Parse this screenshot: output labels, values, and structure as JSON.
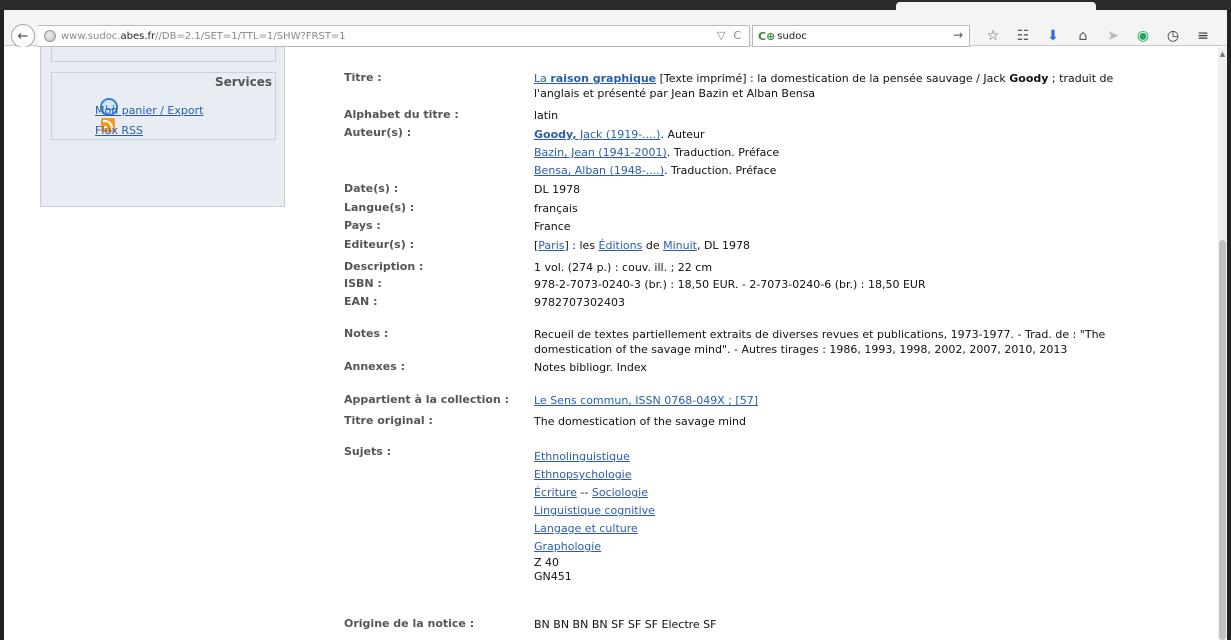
{
  "browser": {
    "url_prefix": "www.sudoc.",
    "url_host": "abes.fr",
    "url_path": "//DB=2.1/SET=1/TTL=1/SHW?FRST=1",
    "search_text": "sudoc",
    "reload_glyph": "C",
    "dropdown_glyph": "▽"
  },
  "services": {
    "title": "Services",
    "items": [
      {
        "label": "Mon panier / Export",
        "icon": "basket-icon"
      },
      {
        "label": "Flux RSS",
        "icon": "rss-icon"
      }
    ]
  },
  "record": {
    "titre": {
      "label": "Titre :",
      "link": "La ",
      "link_bold": "raison graphique",
      "rest1": " [Texte imprimé] : la domestication de la pensée sauvage / Jack ",
      "author_bold": "Goody",
      "rest2": " ; traduit de",
      "line2": "l'anglais et présenté par Jean Bazin et Alban Bensa"
    },
    "alphabet": {
      "label": "Alphabet du titre :",
      "value": "latin"
    },
    "auteurs": {
      "label": "Auteur(s) :",
      "items": [
        {
          "link_bold": "Goody,",
          "link": " Jack (1919-....)",
          "role": ". Auteur"
        },
        {
          "link_bold": "",
          "link": "Bazin, Jean (1941-2001)",
          "role": ". Traduction. Préface"
        },
        {
          "link_bold": "",
          "link": "Bensa, Alban (1948-....)",
          "role": ". Traduction. Préface"
        }
      ]
    },
    "dates": {
      "label": "Date(s) :",
      "value": "DL 1978"
    },
    "langues": {
      "label": "Langue(s) :",
      "value": "français"
    },
    "pays": {
      "label": "Pays :",
      "value": "France"
    },
    "editeur": {
      "label": "Editeur(s) :",
      "open": "[",
      "place": "Paris",
      "mid1": "] : les ",
      "ed": "Éditions",
      "mid2": " de ",
      "name": "Minuit",
      "end": ", DL 1978"
    },
    "description": {
      "label": "Description :",
      "value": "1 vol. (274 p.) : couv. ill. ; 22 cm"
    },
    "isbn": {
      "label": "ISBN :",
      "value": "978-2-7073-0240-3 (br.) : 18,50 EUR. - 2-7073-0240-6 (br.) : 18,50 EUR"
    },
    "ean": {
      "label": "EAN :",
      "value": "9782707302403"
    },
    "notes": {
      "label": "Notes :",
      "line1": "Recueil de textes partiellement extraits de diverses revues et publications, 1973-1977. - Trad. de : \"The",
      "line2": "domestication of the savage mind\". - Autres tirages : 1986, 1993, 1998, 2002, 2007, 2010, 2013"
    },
    "annexes": {
      "label": "Annexes :",
      "value": "Notes bibliogr. Index"
    },
    "collection": {
      "label": "Appartient à la collection :",
      "value": "Le Sens commun, ISSN 0768-049X ; [57]"
    },
    "titre_original": {
      "label": "Titre original :",
      "value": "The domestication of the savage mind"
    },
    "sujets": {
      "label": "Sujets :",
      "items": [
        "Ethnolinguistique",
        "Ethnopsychologie"
      ],
      "ecriture": "Écriture",
      "sep": " -- ",
      "sociologie": "Sociologie",
      "items2": [
        "Linguistique cognitive",
        "Langage et culture",
        "Graphologie"
      ],
      "codes": [
        "Z 40",
        "GN451"
      ]
    },
    "origine": {
      "label": "Origine de la notice :",
      "value": "BN BN BN BN SF SF SF Electre SF"
    }
  }
}
